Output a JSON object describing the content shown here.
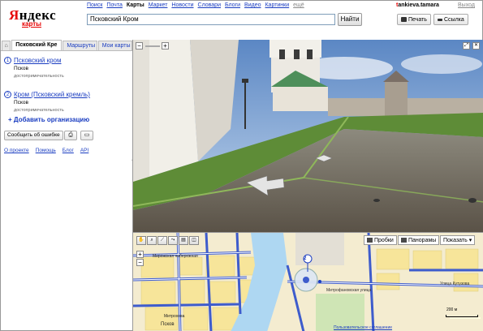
{
  "header": {
    "logo_text": "Яндекс",
    "logo_sub": "карты",
    "services": [
      "Поиск",
      "Почта",
      "Карты",
      "Маркет",
      "Новости",
      "Словари",
      "Блоги",
      "Видео",
      "Картинки",
      "ещё"
    ],
    "active_service": "Карты",
    "user_first": "t",
    "user_rest": "ankieva.tamara",
    "logout": "Выход",
    "search_value": "Псковский Кром",
    "search_button": "Найти",
    "print_button": "Печать",
    "link_button": "Ссылка"
  },
  "sidebar": {
    "tabs": [
      "Псковский Кре",
      "Маршруты",
      "Мои карты"
    ],
    "results": [
      {
        "num": "1",
        "title": "Псковский кром",
        "city": "Псков",
        "type": "достопримечательность"
      },
      {
        "num": "2",
        "title": "Кром (Псковский кремль)",
        "city": "Псков",
        "type": "достопримечательность"
      }
    ],
    "add_org": "+ Добавить организацию",
    "report_error": "Сообщить об ошибке",
    "footer_links": [
      "О проекте",
      "Помощь",
      "Блог",
      "API"
    ]
  },
  "map": {
    "layer_buttons": [
      "Пробки",
      "Панорамы",
      "Показать"
    ],
    "labels": {
      "district": "Мирожская набережная",
      "city": "Псков",
      "mitrokhova": "Митрохова",
      "street1": "Митрофановская улица",
      "street2": "Улица Кутузова"
    },
    "marker": "2",
    "scale": "200 м",
    "copyright": "Пользовательское соглашение",
    "yandex": "© Яндекс"
  },
  "colors": {
    "accent_red": "#e60000",
    "link_blue": "#1a3dc1",
    "road_blue": "#3e5ccc",
    "river": "#aed7f2"
  }
}
